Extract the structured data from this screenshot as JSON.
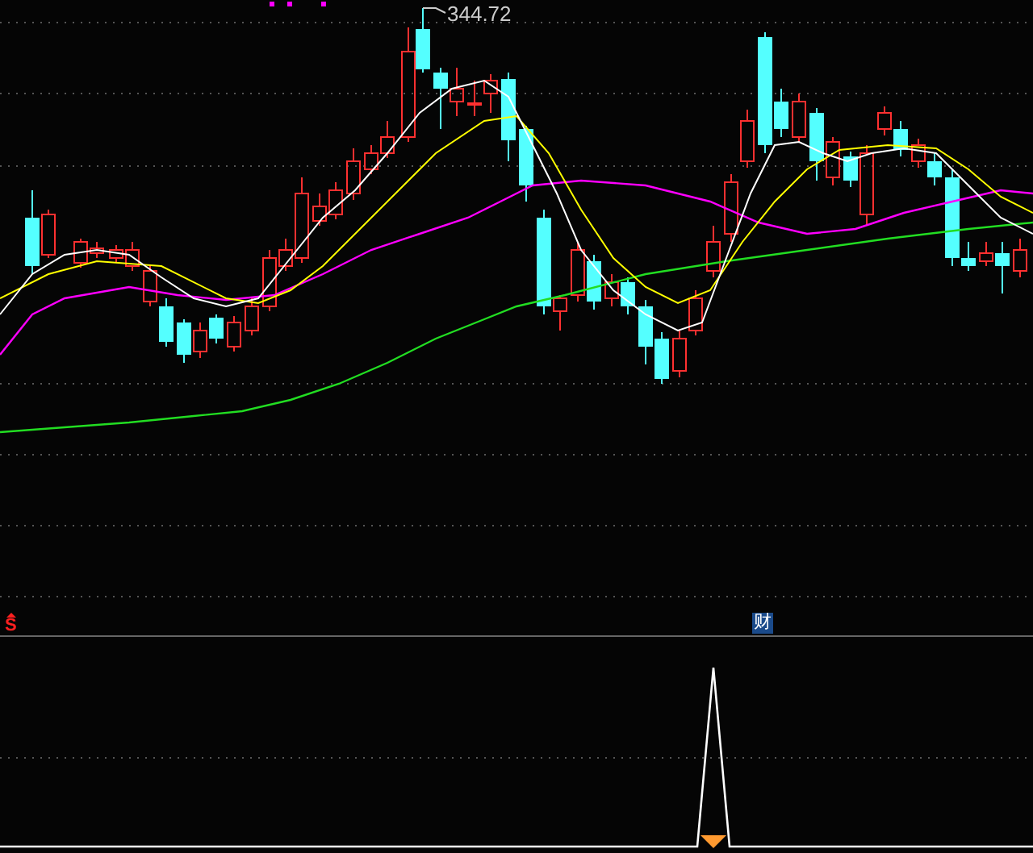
{
  "price_chart": {
    "high_label": "344.72"
  },
  "signals": [
    {
      "label": "S",
      "kind": "sell"
    },
    {
      "label": "财",
      "kind": "badge"
    }
  ]
}
